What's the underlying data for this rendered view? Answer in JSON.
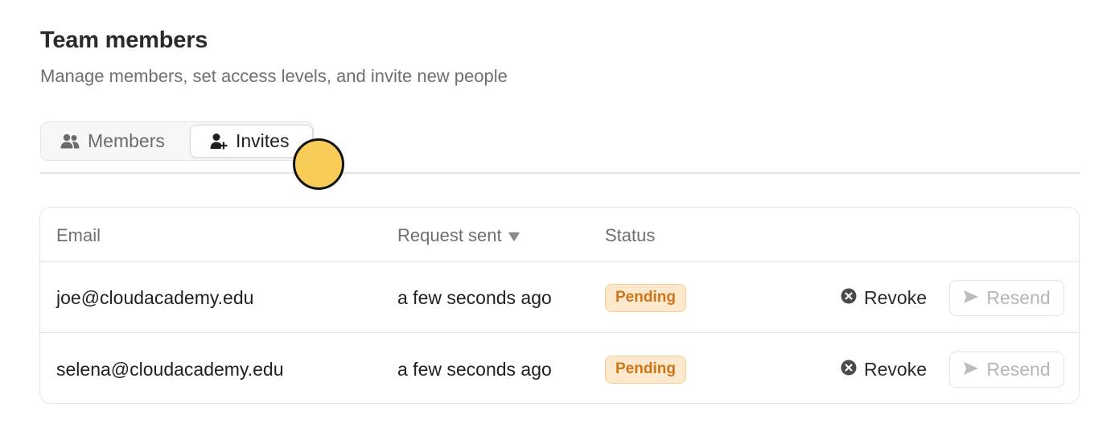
{
  "header": {
    "title": "Team members",
    "subtitle": "Manage members, set access levels, and invite new people"
  },
  "tabs": [
    {
      "label": "Members",
      "icon": "users-icon",
      "active": false
    },
    {
      "label": "Invites",
      "icon": "user-plus-icon",
      "active": true
    }
  ],
  "table": {
    "columns": {
      "email": "Email",
      "request_sent": "Request sent",
      "status": "Status"
    },
    "sort": {
      "column": "request_sent",
      "direction": "desc",
      "icon": "caret-down-icon"
    },
    "rows": [
      {
        "email": "joe@cloudacademy.edu",
        "request_sent": "a few seconds ago",
        "status": "Pending",
        "revoke_label": "Revoke",
        "resend_label": "Resend"
      },
      {
        "email": "selena@cloudacademy.edu",
        "request_sent": "a few seconds ago",
        "status": "Pending",
        "revoke_label": "Revoke",
        "resend_label": "Resend"
      }
    ]
  },
  "colors": {
    "pending_badge_bg": "#fce8cc",
    "pending_badge_text": "#cf7418",
    "cursor_marker": "#f7cc57"
  }
}
